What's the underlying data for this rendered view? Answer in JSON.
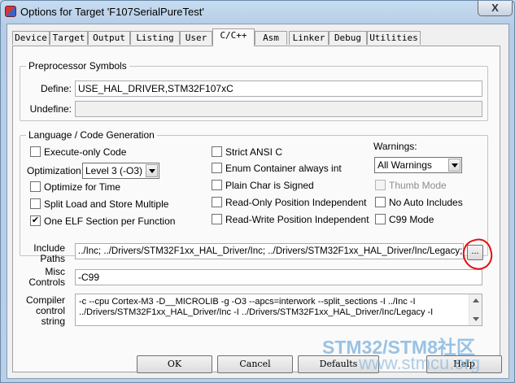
{
  "window": {
    "title": "Options for Target 'F107SerialPureTest'",
    "close_glyph": "X"
  },
  "tabs": [
    "Device",
    "Target",
    "Output",
    "Listing",
    "User",
    "C/C++",
    "Asm",
    "Linker",
    "Debug",
    "Utilities"
  ],
  "active_tab": "C/C++",
  "preprocessor": {
    "legend": "Preprocessor Symbols",
    "define_label": "Define:",
    "define_value": "USE_HAL_DRIVER,STM32F107xC",
    "undefine_label": "Undefine:",
    "undefine_value": ""
  },
  "language": {
    "legend": "Language / Code Generation",
    "execute_only": {
      "label": "Execute-only Code",
      "checked": false
    },
    "optimization_label": "Optimization:",
    "optimization_value": "Level 3 (-O3)",
    "optimize_time": {
      "label": "Optimize for Time",
      "checked": false
    },
    "split_load": {
      "label": "Split Load and Store Multiple",
      "checked": false
    },
    "one_elf": {
      "label": "One ELF Section per Function",
      "checked": true
    },
    "strict_ansi": {
      "label": "Strict ANSI C",
      "checked": false
    },
    "enum_container": {
      "label": "Enum Container always int",
      "checked": false
    },
    "plain_char": {
      "label": "Plain Char is Signed",
      "checked": false
    },
    "ro_pi": {
      "label": "Read-Only Position Independent",
      "checked": false
    },
    "rw_pi": {
      "label": "Read-Write Position Independent",
      "checked": false
    },
    "warnings_label": "Warnings:",
    "warnings_value": "All Warnings",
    "thumb_mode": {
      "label": "Thumb Mode",
      "checked": false
    },
    "no_auto_includes": {
      "label": "No Auto Includes",
      "checked": false
    },
    "c99_mode": {
      "label": "C99 Mode",
      "checked": false
    }
  },
  "include_paths": {
    "label_line1": "Include",
    "label_line2": "Paths",
    "value": "../Inc;  ../Drivers/STM32F1xx_HAL_Driver/Inc;  ../Drivers/STM32F1xx_HAL_Driver/Inc/Legacy;",
    "browse_label": "..."
  },
  "misc_controls": {
    "label_line1": "Misc",
    "label_line2": "Controls",
    "value": "-C99"
  },
  "compiler_control": {
    "label_line1": "Compiler",
    "label_line2": "control",
    "label_line3": "string",
    "line1": "-c --cpu Cortex-M3 -D__MICROLIB -g -O3 --apcs=interwork --split_sections -I ../Inc -I",
    "line2": "../Drivers/STM32F1xx_HAL_Driver/Inc -I ../Drivers/STM32F1xx_HAL_Driver/Inc/Legacy -I"
  },
  "buttons": {
    "ok": "OK",
    "cancel": "Cancel",
    "defaults": "Defaults",
    "help": "Help"
  },
  "watermark": {
    "line1": "STM32/STM8社区",
    "line2": "www.stmcu.org"
  },
  "colors": {
    "annotation_circle": "#e01010",
    "watermark": "#78afdc"
  }
}
